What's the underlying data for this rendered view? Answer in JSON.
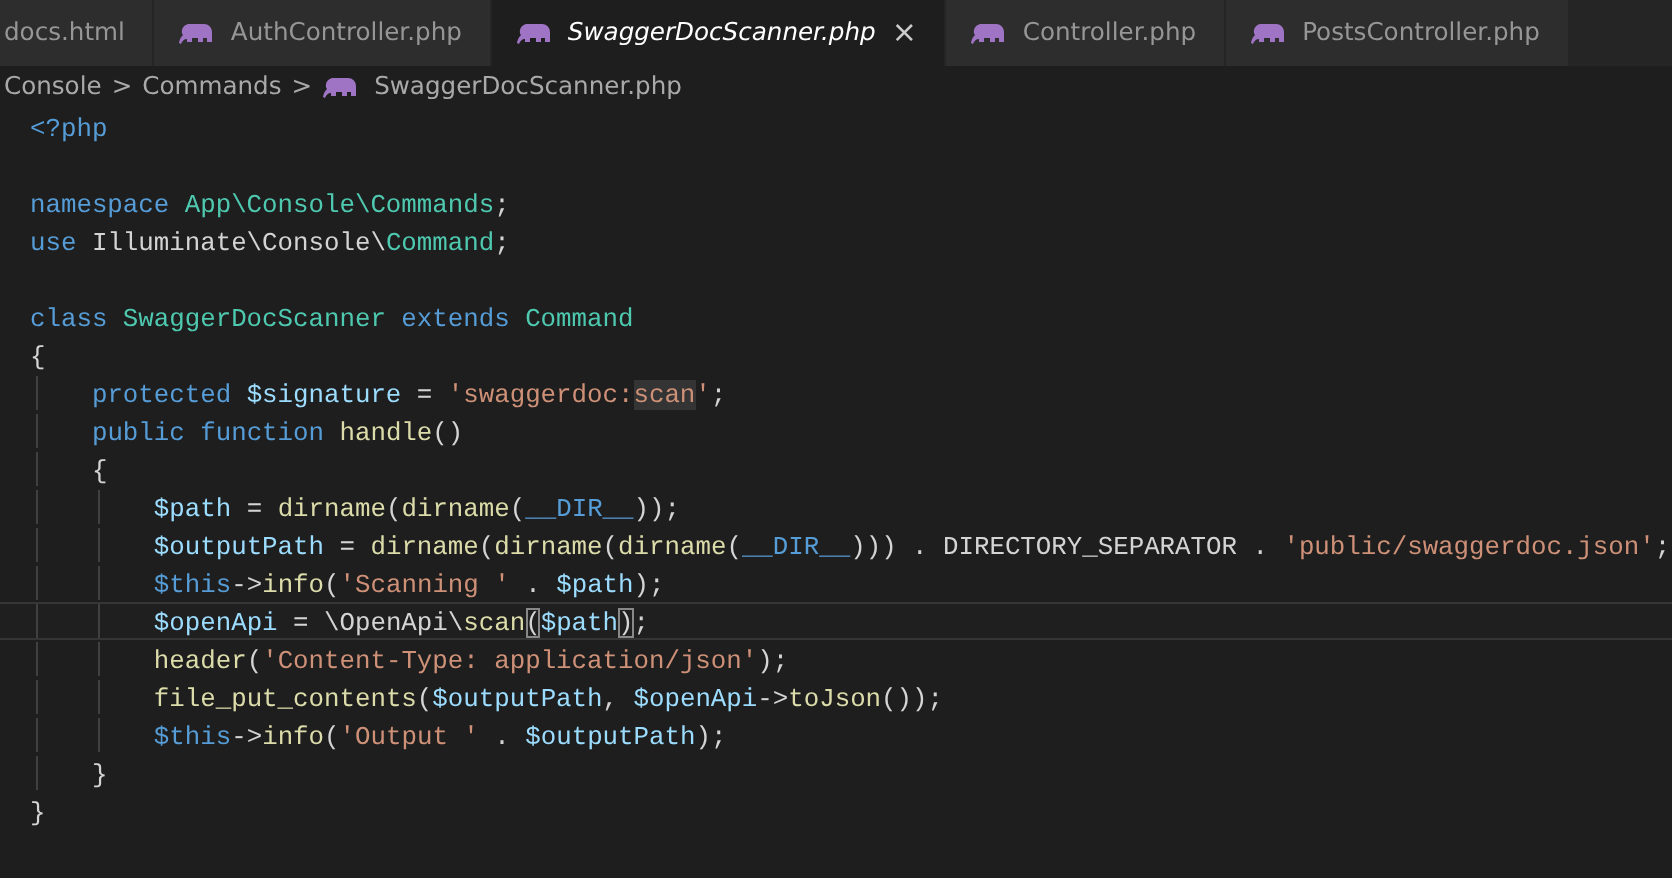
{
  "tabs": [
    {
      "label": "docs.html",
      "icon": false,
      "selected": false,
      "italic": false
    },
    {
      "label": "AuthController.php",
      "icon": true,
      "selected": false,
      "italic": false
    },
    {
      "label": "SwaggerDocScanner.php",
      "icon": true,
      "selected": true,
      "italic": true,
      "close": "×"
    },
    {
      "label": "Controller.php",
      "icon": true,
      "selected": false,
      "italic": false
    },
    {
      "label": "PostsController.php",
      "icon": true,
      "selected": false,
      "italic": false
    }
  ],
  "breadcrumbs": [
    {
      "label": "Console",
      "icon": false
    },
    {
      "label": "Commands",
      "icon": false
    },
    {
      "label": "SwaggerDocScanner.php",
      "icon": true
    }
  ],
  "breadcrumb_separator": ">",
  "lines": [
    {
      "current": false,
      "tokens": [
        {
          "t": "<?php",
          "kind": "keyword"
        }
      ]
    },
    {
      "current": false
    },
    {
      "current": false,
      "tokens": [
        {
          "t": "namespace",
          "kind": "keyword"
        },
        {
          "t": " App\\Console\\Commands",
          "kind": "type"
        },
        {
          "t": ";",
          "kind": "plain"
        }
      ]
    },
    {
      "current": false,
      "tokens": [
        {
          "t": "use",
          "kind": "keyword"
        },
        {
          "t": " Illuminate\\Console\\",
          "kind": "plain"
        },
        {
          "t": "Command",
          "kind": "type"
        },
        {
          "t": ";",
          "kind": "plain"
        }
      ]
    },
    {
      "current": false
    },
    {
      "current": false,
      "tokens": [
        {
          "t": "class",
          "kind": "keyword"
        },
        {
          "t": " SwaggerDocScanner",
          "kind": "type"
        },
        {
          "t": " extends",
          "kind": "keyword"
        },
        {
          "t": " Command",
          "kind": "type"
        }
      ]
    },
    {
      "current": false,
      "tokens": [
        {
          "t": "{",
          "kind": "plain"
        }
      ],
      "children": [
        {
          "current": false,
          "tokens": [
            {
              "t": "protected",
              "kind": "keyword"
            },
            {
              "t": " $signature",
              "kind": "variable"
            },
            {
              "t": " = ",
              "kind": "plain"
            },
            {
              "t": "'swaggerdoc:",
              "kind": "string"
            },
            {
              "t": "scan",
              "kind": "match"
            },
            {
              "t": "'",
              "kind": "string"
            },
            {
              "t": ";",
              "kind": "plain"
            }
          ]
        },
        {
          "current": false,
          "tokens": [
            {
              "t": "public",
              "kind": "keyword"
            },
            {
              "t": " function",
              "kind": "keyword"
            },
            {
              "t": " handle",
              "kind": "function"
            },
            {
              "t": "()",
              "kind": "plain"
            }
          ]
        },
        {
          "current": false,
          "tokens": [
            {
              "t": "{",
              "kind": "plain"
            }
          ],
          "children": [
            {
              "current": false,
              "tokens": [
                {
                  "t": "$path",
                  "kind": "variable"
                },
                {
                  "t": " = ",
                  "kind": "plain"
                },
                {
                  "t": "dirname",
                  "kind": "function"
                },
                {
                  "t": "(",
                  "kind": "plain"
                },
                {
                  "t": "dirname",
                  "kind": "function"
                },
                {
                  "t": "(",
                  "kind": "plain"
                },
                {
                  "t": "__DIR__",
                  "kind": "keyword"
                },
                {
                  "t": "));",
                  "kind": "plain"
                }
              ]
            },
            {
              "current": false,
              "tokens": [
                {
                  "t": "$outputPath",
                  "kind": "variable"
                },
                {
                  "t": " = ",
                  "kind": "plain"
                },
                {
                  "t": "dirname",
                  "kind": "function"
                },
                {
                  "t": "(",
                  "kind": "plain"
                },
                {
                  "t": "dirname",
                  "kind": "function"
                },
                {
                  "t": "(",
                  "kind": "plain"
                },
                {
                  "t": "dirname",
                  "kind": "function"
                },
                {
                  "t": "(",
                  "kind": "plain"
                },
                {
                  "t": "__DIR__",
                  "kind": "keyword"
                },
                {
                  "t": "))) . DIRECTORY_SEPARATOR . ",
                  "kind": "plain"
                },
                {
                  "t": "'public/swaggerdoc.json'",
                  "kind": "string"
                },
                {
                  "t": ";",
                  "kind": "plain"
                }
              ]
            },
            {
              "current": false,
              "tokens": [
                {
                  "t": "$this",
                  "kind": "keyword"
                },
                {
                  "t": "->",
                  "kind": "plain"
                },
                {
                  "t": "info",
                  "kind": "function"
                },
                {
                  "t": "(",
                  "kind": "plain"
                },
                {
                  "t": "'Scanning '",
                  "kind": "string"
                },
                {
                  "t": " . ",
                  "kind": "plain"
                },
                {
                  "t": "$path",
                  "kind": "variable"
                },
                {
                  "t": ");",
                  "kind": "plain"
                }
              ]
            },
            {
              "current": true,
              "tokens": [
                {
                  "t": "$openApi",
                  "kind": "variable"
                },
                {
                  "t": " = \\OpenApi\\",
                  "kind": "plain"
                },
                {
                  "t": "scan",
                  "kind": "function"
                },
                {
                  "t": "(",
                  "kind": "bracket"
                },
                {
                  "t": "$path",
                  "kind": "variable"
                },
                {
                  "t": ")",
                  "kind": "bracket"
                },
                {
                  "t": ";",
                  "kind": "plain"
                }
              ]
            },
            {
              "current": false,
              "tokens": [
                {
                  "t": "header",
                  "kind": "function"
                },
                {
                  "t": "(",
                  "kind": "plain"
                },
                {
                  "t": "'Content-Type: application/json'",
                  "kind": "string"
                },
                {
                  "t": ");",
                  "kind": "plain"
                }
              ]
            },
            {
              "current": false,
              "tokens": [
                {
                  "t": "file_put_contents",
                  "kind": "function"
                },
                {
                  "t": "(",
                  "kind": "plain"
                },
                {
                  "t": "$outputPath",
                  "kind": "variable"
                },
                {
                  "t": ", ",
                  "kind": "plain"
                },
                {
                  "t": "$openApi",
                  "kind": "variable"
                },
                {
                  "t": "->",
                  "kind": "plain"
                },
                {
                  "t": "toJson",
                  "kind": "function"
                },
                {
                  "t": "());",
                  "kind": "plain"
                }
              ]
            },
            {
              "current": false,
              "tokens": [
                {
                  "t": "$this",
                  "kind": "keyword"
                },
                {
                  "t": "->",
                  "kind": "plain"
                },
                {
                  "t": "info",
                  "kind": "function"
                },
                {
                  "t": "(",
                  "kind": "plain"
                },
                {
                  "t": "'Output '",
                  "kind": "string"
                },
                {
                  "t": " . ",
                  "kind": "plain"
                },
                {
                  "t": "$outputPath",
                  "kind": "variable"
                },
                {
                  "t": ");",
                  "kind": "plain"
                }
              ]
            }
          ]
        },
        {
          "current": false,
          "tokens": [
            {
              "t": "}",
              "kind": "plain"
            }
          ]
        }
      ]
    },
    {
      "current": false,
      "tokens": [
        {
          "t": "}",
          "kind": "plain"
        }
      ]
    }
  ]
}
